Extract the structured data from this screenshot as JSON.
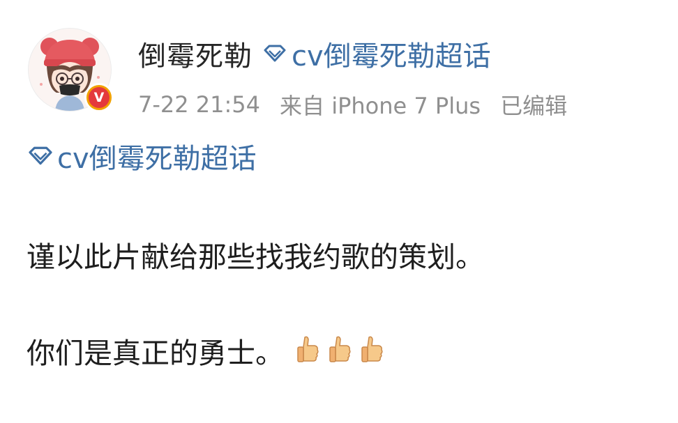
{
  "post": {
    "author": "倒霉死勒",
    "topic_tag": "cv倒霉死勒超话",
    "time": "7-22 21:54",
    "source": "来自 iPhone 7 Plus",
    "edited": "已编辑",
    "verified_badge": "V",
    "body_topic": "cv倒霉死勒超话",
    "paragraphs": [
      "谨以此片献给那些找我约歌的策划。",
      "你们是真正的勇士。"
    ],
    "emoji": [
      "thumbs-up-icon",
      "thumbs-up-icon",
      "thumbs-up-icon"
    ]
  },
  "colors": {
    "link": "#3e6fa5",
    "meta": "#8f8f8f",
    "text": "#1e1e1e",
    "badge_outer": "#f2a100",
    "badge_inner": "#e4393c"
  }
}
